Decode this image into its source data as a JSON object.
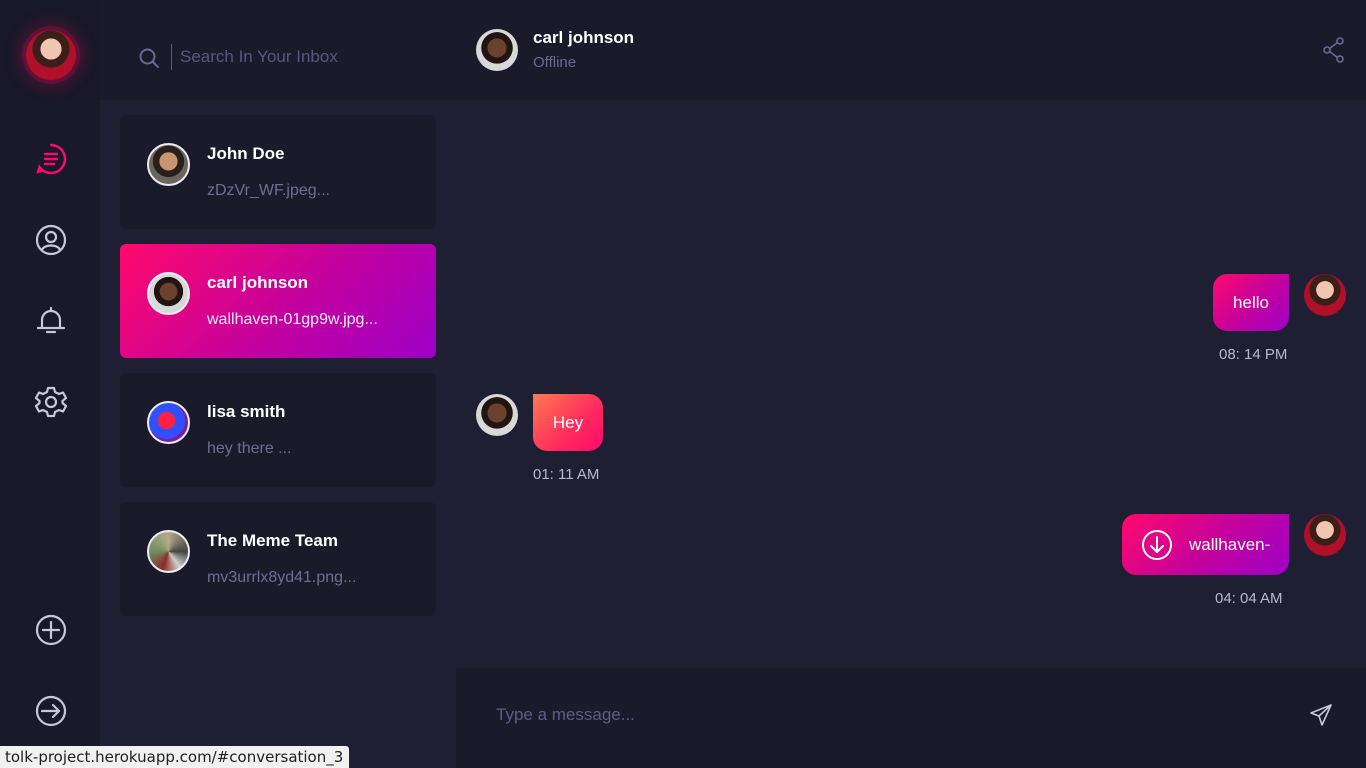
{
  "search": {
    "placeholder": "Search In Your Inbox"
  },
  "rail": {
    "icons": [
      "chats-icon",
      "profile-icon",
      "notifications-icon",
      "settings-icon",
      "add-icon",
      "logout-icon"
    ],
    "active_color": "#ff0a6c",
    "icon_color": "#c8c8dc"
  },
  "conversations": [
    {
      "name": "John Doe",
      "preview": "zDzVr_WF.jpeg..."
    },
    {
      "name": "carl johnson",
      "preview": "wallhaven-01gp9w.jpg..."
    },
    {
      "name": "lisa smith",
      "preview": "hey there ..."
    },
    {
      "name": "The Meme Team",
      "preview": "mv3urrlx8yd41.png..."
    }
  ],
  "chat": {
    "name": "carl johnson",
    "status": "Offline",
    "messages": [
      {
        "text": "hello",
        "time": "08: 14 PM"
      },
      {
        "text": "Hey",
        "time": "01: 11 AM"
      },
      {
        "text": "wallhaven-",
        "time": "04: 04 AM"
      }
    ]
  },
  "composer": {
    "placeholder": "Type a message..."
  },
  "status_url": "tolk-project.herokuapp.com/#conversation_3",
  "colors": {
    "accent": "#ff0a6c",
    "accent_end": "#9d00c8",
    "incoming": "#ff7a50"
  }
}
